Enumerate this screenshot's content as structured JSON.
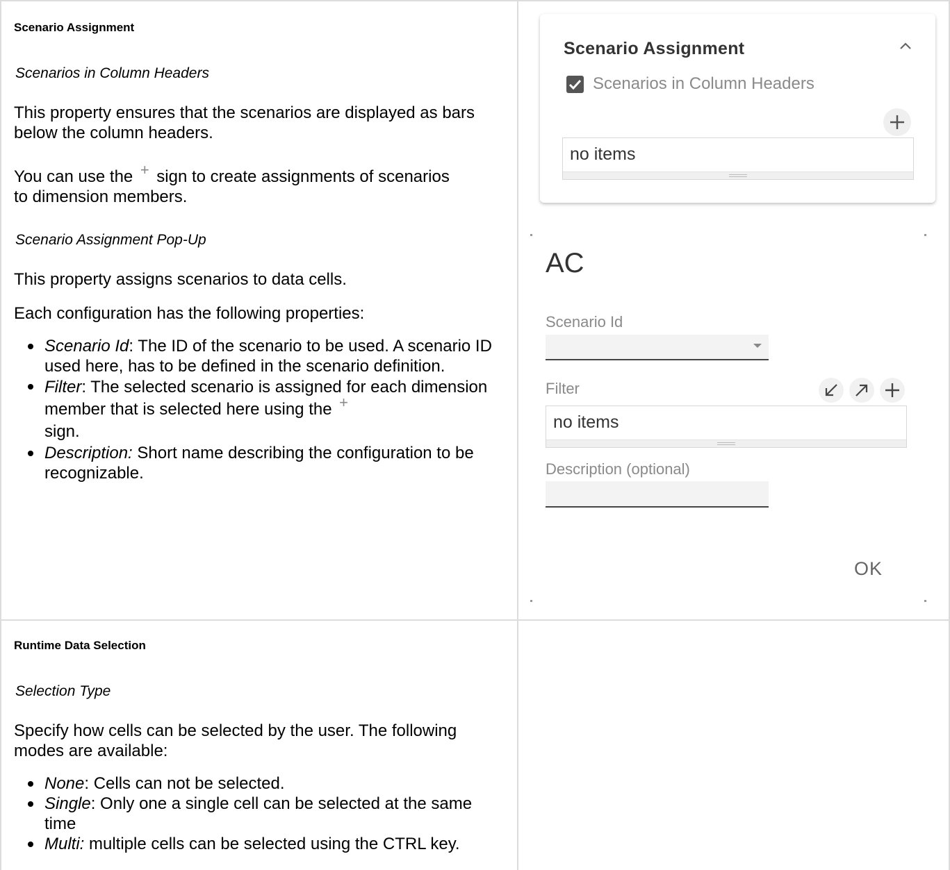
{
  "left": {
    "section1": {
      "heading": "Scenario Assignment",
      "sub1": "Scenarios in Column Headers",
      "para1": "This property ensures that the scenarios are displayed as bars below the column headers.",
      "para2_a": "You can use the",
      "para2_b": "sign to create assignments of scenarios to dimension members.",
      "sub2": "Scenario Assignment Pop-Up",
      "para3": "This property assigns scenarios to data cells.",
      "para4": "Each configuration has the following properties:",
      "bullets": [
        {
          "term": "Scenario Id",
          "text": ": The ID of the scenario to be used. A scenario ID used here, has to be defined in the scenario definition."
        },
        {
          "term": "Filter",
          "text_a": ": The selected scenario is assigned for each dimension member that is selected here using the",
          "text_b": "sign."
        },
        {
          "term": "Description:",
          "text": " Short name describing the configuration to be recognizable."
        }
      ]
    },
    "section2": {
      "heading": "Runtime Data Selection",
      "sub1": "Selection Type",
      "para1": "Specify how cells can be selected by the user. The following modes are available:",
      "bullets": [
        {
          "term": "None",
          "text": ": Cells can not be selected."
        },
        {
          "term": "Single",
          "text": ": Only one a single cell can be selected at the same time"
        },
        {
          "term": "Multi:",
          "text": " multiple cells can be selected using the CTRL key."
        }
      ]
    }
  },
  "card": {
    "title": "Scenario Assignment",
    "checkbox_label": "Scenarios in Column Headers",
    "checked": true,
    "items_text": "no items",
    "icons": [
      "chevron-up-icon",
      "plus-icon",
      "check-icon"
    ]
  },
  "dialog": {
    "title": "AC",
    "scenario_id_label": "Scenario Id",
    "filter_label": "Filter",
    "filter_items_text": "no items",
    "description_label": "Description (optional)",
    "ok_label": "OK",
    "icons": [
      "arrow-down-left-icon",
      "arrow-up-right-icon",
      "plus-icon",
      "dropdown-caret-icon"
    ]
  },
  "colors": {
    "border": "#dcdcdc",
    "checkbox": "#555555",
    "muted_text": "#8a8a8a"
  }
}
